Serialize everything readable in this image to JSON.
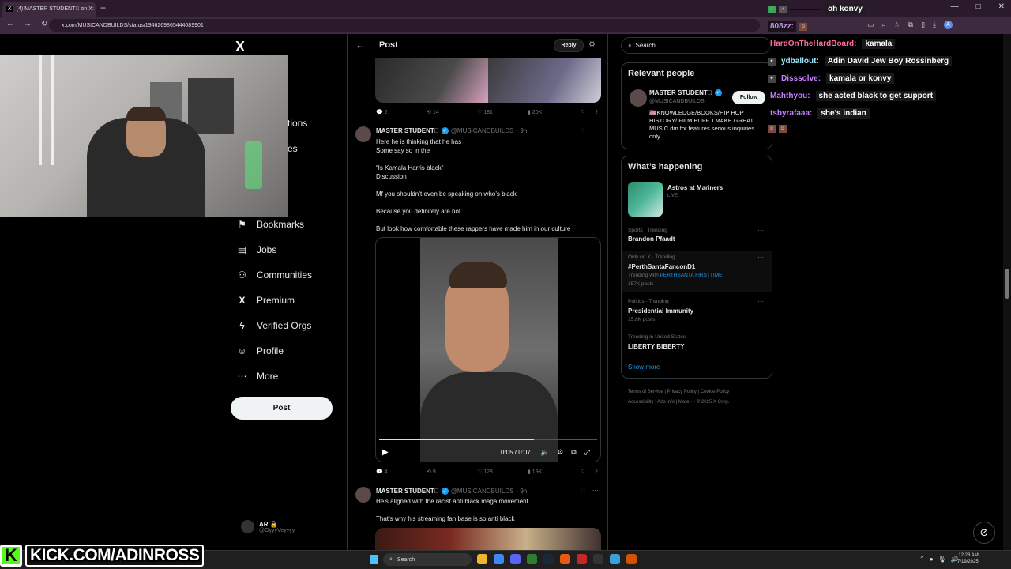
{
  "browser": {
    "tab_title": "(4) MASTER STUDENT🏿 on X:",
    "url": "x.com/MUSICANDBUILDS/status/1946269865444089901",
    "new_tab": "+",
    "window_controls": [
      "—",
      "□",
      "✕"
    ]
  },
  "x": {
    "logo": "X",
    "nav": [
      {
        "label": "Bookmarks",
        "icon": "bookmark-icon",
        "glyph": "⚑"
      },
      {
        "label": "Jobs",
        "icon": "briefcase-icon",
        "glyph": "▤"
      },
      {
        "label": "Communities",
        "icon": "communities-icon",
        "glyph": "⚇"
      },
      {
        "label": "Premium",
        "icon": "x-premium-icon",
        "glyph": "X"
      },
      {
        "label": "Verified Orgs",
        "icon": "lightning-icon",
        "glyph": "ϟ"
      },
      {
        "label": "Profile",
        "icon": "person-icon",
        "glyph": "☺"
      },
      {
        "label": "More",
        "icon": "more-circle-icon",
        "glyph": "⋯"
      }
    ],
    "nav_partial": [
      "tions",
      "es"
    ],
    "post_button": "Post",
    "account": {
      "name": "AR 🔒",
      "handle": "@OyyyVeyyyy",
      "more": "···"
    }
  },
  "header": {
    "title": "Post",
    "reply": "Reply"
  },
  "top_post_actions": {
    "replies": "2",
    "reposts": "14",
    "likes": "181",
    "views": "20K"
  },
  "tweets": [
    {
      "name": "MASTER STUDENT🏿",
      "handle": "@MUSICANDBUILDS",
      "time": "· 9h",
      "lines": [
        "Here he is thinking that he has",
        "Some say so in the",
        "",
        "“Is Kamala Harris black”",
        "Discussion",
        "",
        "Mf you shouldn’t even be speaking on who’s black",
        "",
        "Because you definitely are not",
        "",
        "But look how comfortable these rappers have made him in our culture"
      ],
      "video": {
        "time": "0:05 / 0:07",
        "progress": 0.71
      },
      "actions": {
        "replies": "4",
        "reposts": "9",
        "likes": "128",
        "views": "19K"
      }
    },
    {
      "name": "MASTER STUDENT🏿",
      "handle": "@MUSICANDBUILDS",
      "time": "· 9h",
      "lines": [
        "He’s aligned with the racist anti black maga movement",
        "",
        "That’s why his streaming fan base is so anti black"
      ]
    }
  ],
  "sidebar": {
    "search_placeholder": "Search",
    "relevant_title": "Relevant people",
    "person": {
      "name": "MASTER STUDENT🏿",
      "handle": "@MUSICANDBUILDS",
      "follow": "Follow",
      "bio": "🇺🇸KNOWLEDGE/BOOKS/HIP HOP HISTORY/ FILM BUFF..I MAKE GREAT MUSIC dm for features serious inquiries only"
    },
    "happening_title": "What’s happening",
    "event": {
      "title": "Astros at Mariners",
      "sub": "LIVE"
    },
    "trends": [
      {
        "meta": "Sports · Trending",
        "name": "Brandon Pfaadt",
        "posts": ""
      },
      {
        "meta": "Only on X · Trending",
        "name": "#PerthSantaFanconD1",
        "with_label": "Trending with",
        "with_tag": "PERTHSANTA FIRSTTIME",
        "posts": "157K posts"
      },
      {
        "meta": "Politics · Trending",
        "name": "Presidential Immunity",
        "posts": "15.8K posts"
      },
      {
        "meta": "Trending in United States",
        "name": "LIBERTY BIBERTY",
        "posts": ""
      }
    ],
    "show_more": "Show more",
    "footer": [
      "Terms of Service",
      "|",
      "Privacy Policy",
      "|",
      "Cookie Policy",
      "|",
      "Accessibility",
      "|",
      "Ads info",
      "|",
      "More ···",
      "© 2025 X Corp."
    ]
  },
  "chat": [
    {
      "user": "",
      "msg": "oh konvy",
      "color": "#ff6b6b"
    },
    {
      "user": "808zz:",
      "msg": "",
      "color": "#c792ea"
    },
    {
      "user": "HardOnTheHardBoard:",
      "msg": "kamala",
      "color": "#ff6b9d"
    },
    {
      "user": "ydballout:",
      "msg": "Adin David Jew Boy Rossinberg",
      "color": "#9be8ff"
    },
    {
      "user": "Disssolve:",
      "msg": "kamala or konvy",
      "color": "#c77dff"
    },
    {
      "user": "Mahthyou:",
      "msg": "she acted black to get support",
      "color": "#c77dff"
    },
    {
      "user": "tsbyrafaaa:",
      "msg": "she’s indian",
      "color": "#c77dff"
    }
  ],
  "kick_banner": {
    "k": "K",
    "text": "KICK.COM/ADINROSS"
  },
  "taskbar": {
    "search": "Search",
    "time": "12:28 AM",
    "date": "7/19/2025"
  },
  "colors": {
    "accent": "#1d9bf0",
    "kick": "#53fc18",
    "browser": "#3d2a3f"
  }
}
